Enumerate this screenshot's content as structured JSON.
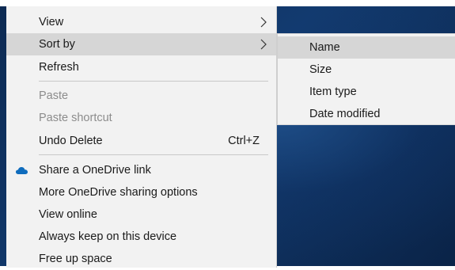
{
  "context_menu": {
    "items": [
      {
        "label": "View",
        "has_submenu": true
      },
      {
        "label": "Sort by",
        "has_submenu": true,
        "highlighted": true
      },
      {
        "label": "Refresh"
      },
      {
        "label": "Paste",
        "disabled": true
      },
      {
        "label": "Paste shortcut",
        "disabled": true
      },
      {
        "label": "Undo Delete",
        "shortcut": "Ctrl+Z"
      },
      {
        "label": "Share a OneDrive link",
        "icon": "onedrive-cloud-icon"
      },
      {
        "label": "More OneDrive sharing options"
      },
      {
        "label": "View online"
      },
      {
        "label": "Always keep on this device"
      },
      {
        "label": "Free up space"
      }
    ]
  },
  "submenu": {
    "items": [
      {
        "label": "Name",
        "highlighted": true
      },
      {
        "label": "Size"
      },
      {
        "label": "Item type"
      },
      {
        "label": "Date modified"
      }
    ]
  },
  "colors": {
    "menu_background": "#f2f2f2",
    "highlight": "#d6d6d6",
    "disabled_text": "#8c8c8c",
    "onedrive_blue": "#0f6cbd",
    "desktop_blue": "#123a6e"
  }
}
